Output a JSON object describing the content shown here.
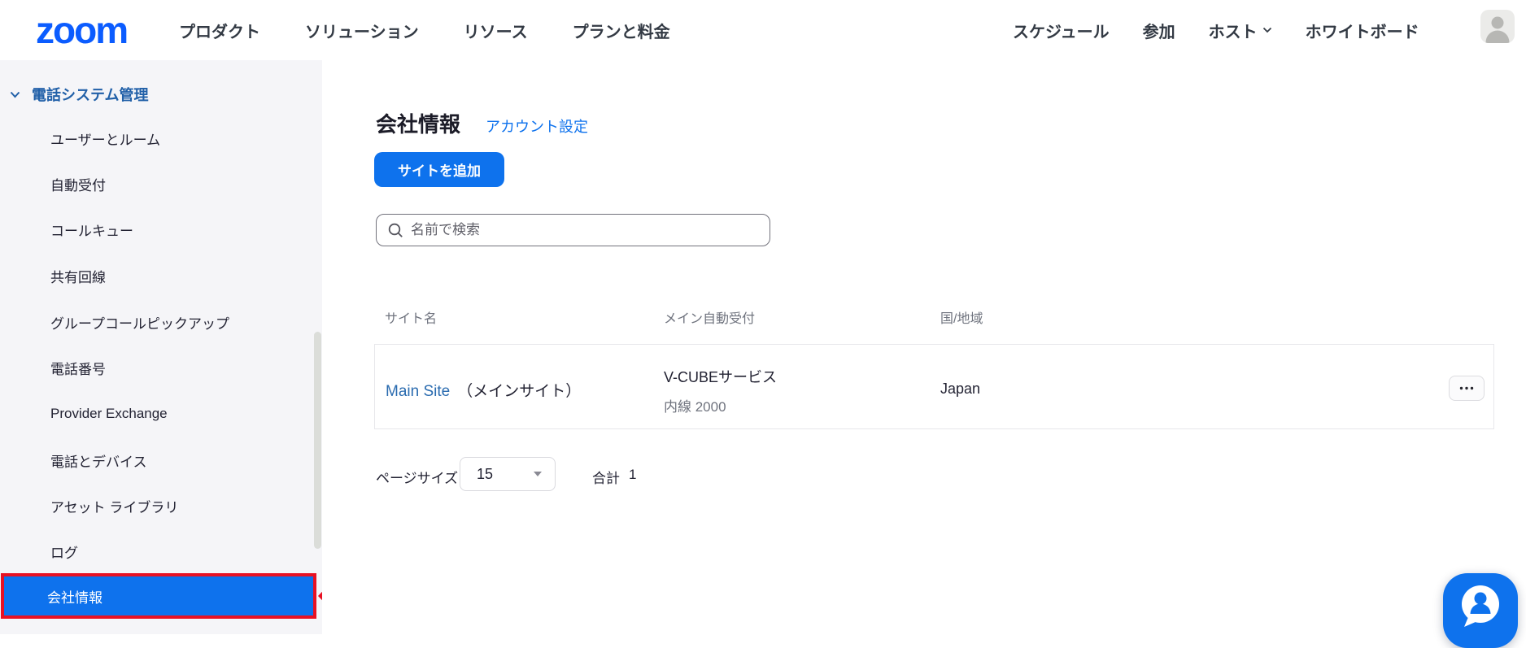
{
  "nav": {
    "logo_text": "zoom",
    "left_items": [
      "プロダクト",
      "ソリューション",
      "リソース",
      "プランと料金"
    ],
    "right_items": [
      "スケジュール",
      "参加",
      "ホスト",
      "ホワイトボード"
    ]
  },
  "sidebar": {
    "section_label": "電話システム管理",
    "items": [
      "ユーザーとルーム",
      "自動受付",
      "コールキュー",
      "共有回線",
      "グループコールピックアップ",
      "電話番号",
      "Provider Exchange",
      "電話とデバイス",
      "アセット ライブラリ",
      "ログ"
    ],
    "selected_item": "会社情報"
  },
  "main": {
    "page_title": "会社情報",
    "settings_link": "アカウント設定",
    "add_site_button": "サイトを追加",
    "search_placeholder": "名前で検索",
    "table": {
      "columns": [
        "サイト名",
        "メイン自動受付",
        "国/地域"
      ],
      "rows": [
        {
          "site_name": "Main Site",
          "site_alias": "（メインサイト）",
          "main_auto_reception": "V-CUBEサービス",
          "extension": "内線 2000",
          "country": "Japan"
        }
      ]
    },
    "pagination": {
      "page_size_label": "ページサイズ",
      "page_size_value": "15",
      "total_label": "合計",
      "total_value": "1"
    }
  },
  "colors": {
    "accent_blue": "#0E72ED",
    "logo_blue": "#0B5CFF",
    "link_blue": "#2B6CB0",
    "sidebar_section_blue": "#2160A8",
    "annotation_red": "#E81123",
    "sidebar_bg": "#F5F5F8",
    "muted_text": "#6F737E"
  }
}
